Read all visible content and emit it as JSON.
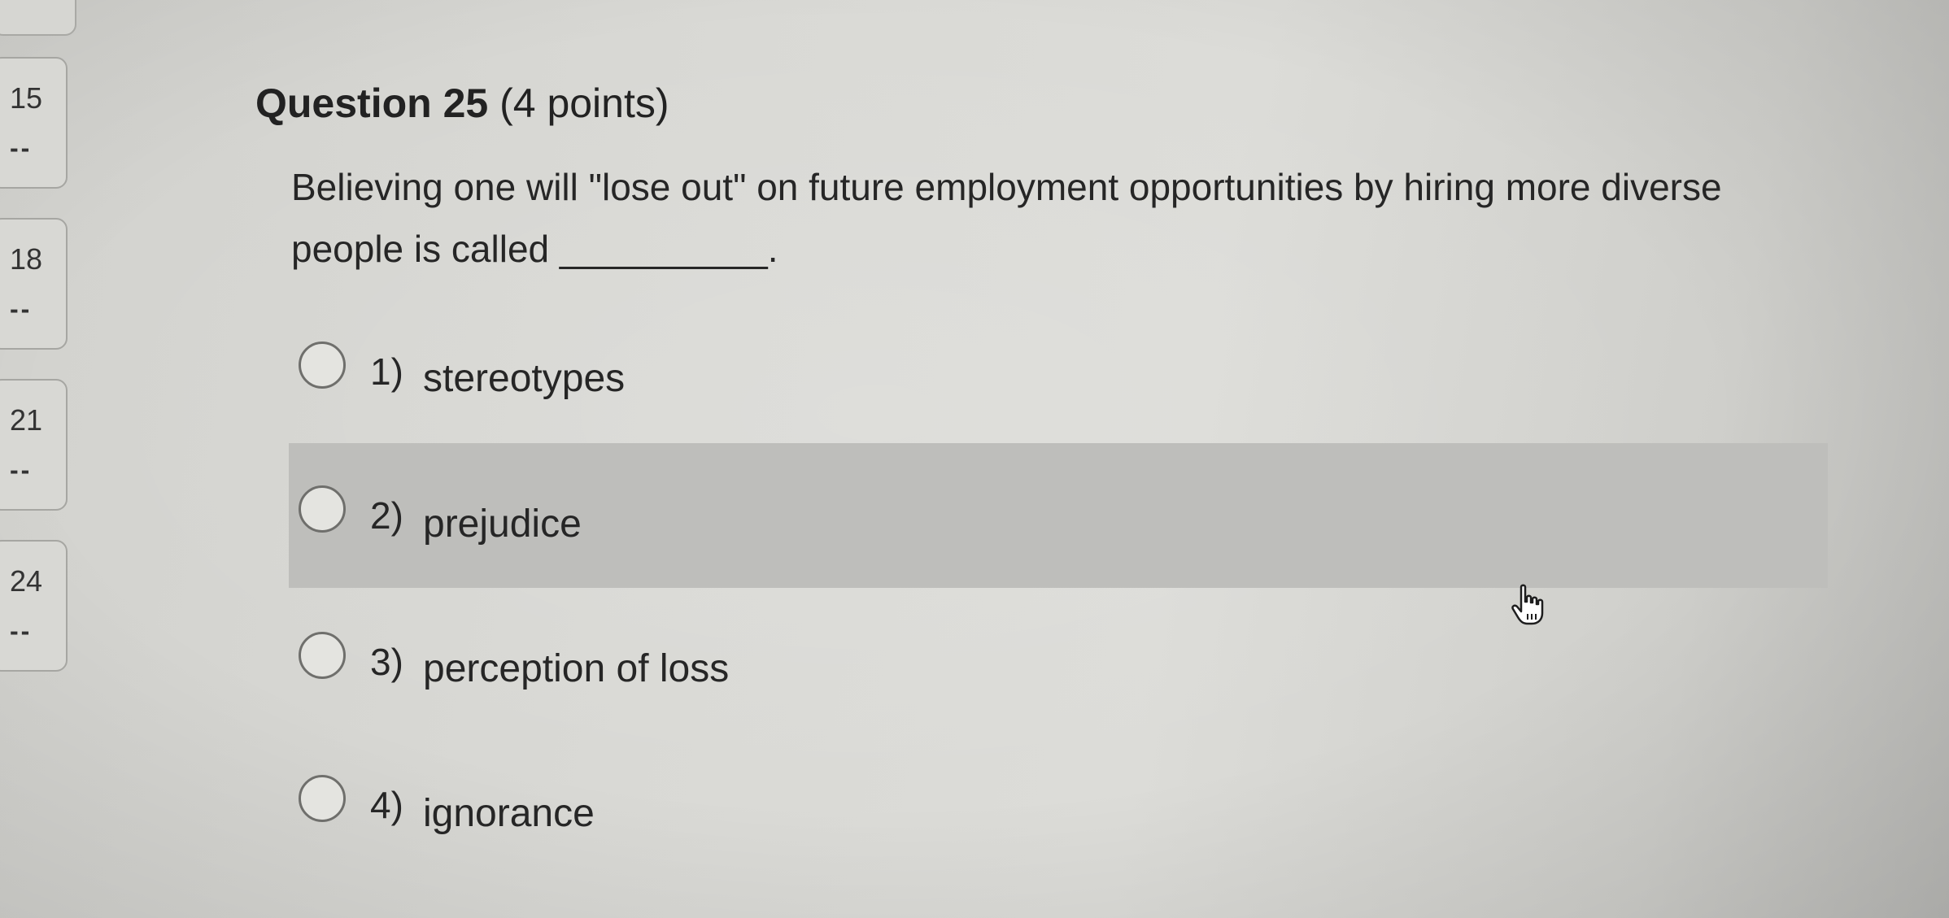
{
  "nav": {
    "items": [
      {
        "number": "15",
        "status": "--"
      },
      {
        "number": "18",
        "status": "--"
      },
      {
        "number": "21",
        "status": "--"
      },
      {
        "number": "24",
        "status": "--"
      }
    ]
  },
  "question": {
    "title": "Question 25",
    "points": "(4 points)",
    "text": "Believing one will \"lose out\" on future employment opportunities by hiring more diverse people is called __________.",
    "options": [
      {
        "number": "1)",
        "label": "stereotypes"
      },
      {
        "number": "2)",
        "label": "prejudice"
      },
      {
        "number": "3)",
        "label": "perception of loss"
      },
      {
        "number": "4)",
        "label": "ignorance"
      }
    ],
    "hovered_option": "2)"
  },
  "cursor": {
    "icon": "hand-pointer-icon"
  },
  "colors": {
    "background": "#d9d9d5",
    "hover_row": "#bebebb",
    "text": "#262626"
  }
}
